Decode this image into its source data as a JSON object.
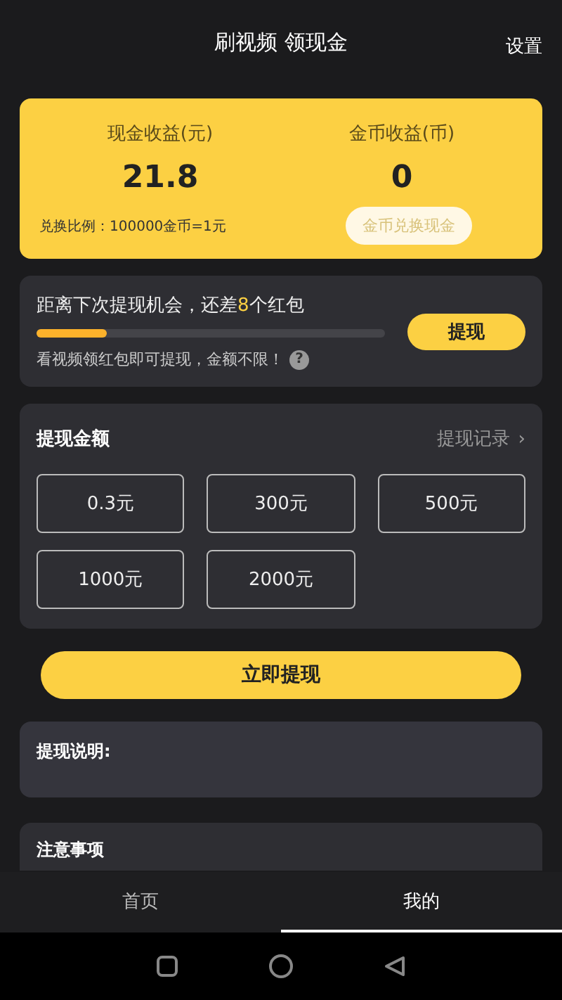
{
  "header": {
    "title": "刷视频 领现金",
    "settings": "设置"
  },
  "earnings": {
    "cash_label": "现金收益(元)",
    "cash_value": "21.8",
    "coin_label": "金币收益(币)",
    "coin_value": "0",
    "rate": "兑换比例：100000金币=1元",
    "exchange_button": "金币兑换现金"
  },
  "progress": {
    "text": "距离下次提现机会，还差**8**个红包",
    "level": 0.2,
    "hint": "看视频领红包即可提现，金额不限！",
    "help": "?",
    "button": "提现"
  },
  "withdraw": {
    "title": "提现金额",
    "records_link": "提现记录",
    "records_arrow": "›",
    "amounts": [
      "0.3元",
      "300元",
      "500元",
      "1000元",
      "2000元"
    ]
  },
  "submit_button": "立即提现",
  "instructions": {
    "title": "提现说明:"
  },
  "notice": {
    "title": "注意事项"
  },
  "tabs": [
    {
      "label": "首页",
      "selected": false
    },
    {
      "label": "我的",
      "selected": true
    }
  ]
}
